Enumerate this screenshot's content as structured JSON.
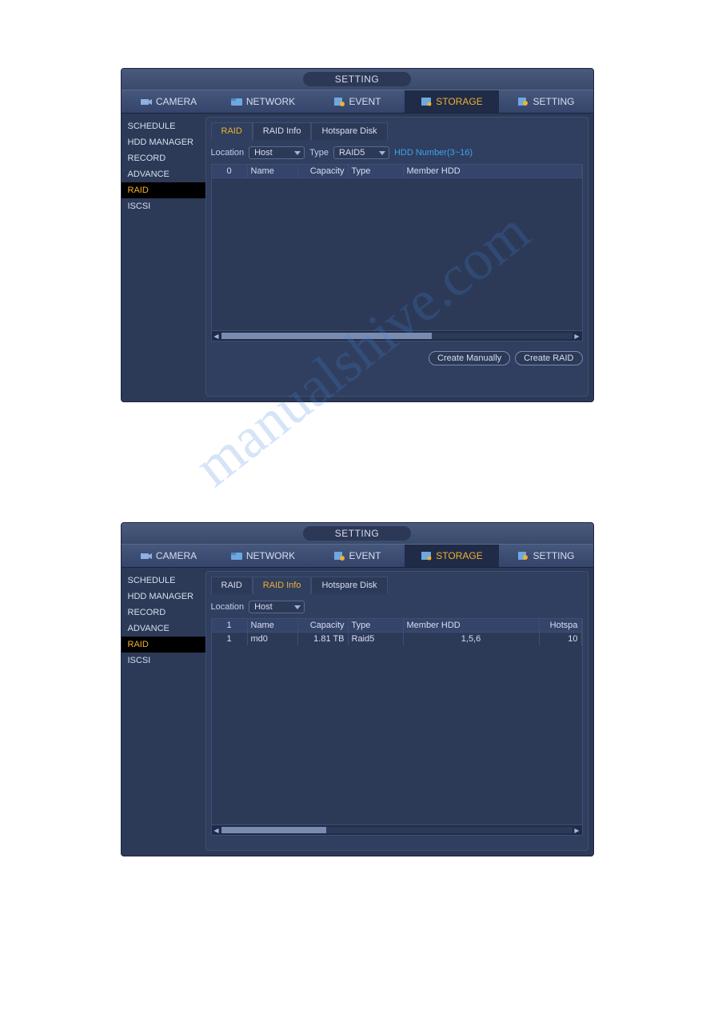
{
  "watermark_text": "manualshive.com",
  "window1": {
    "title": "SETTING",
    "tabs": [
      "CAMERA",
      "NETWORK",
      "EVENT",
      "STORAGE",
      "SETTING"
    ],
    "active_tab": "STORAGE",
    "sidebar": [
      "SCHEDULE",
      "HDD MANAGER",
      "RECORD",
      "ADVANCE",
      "RAID",
      "ISCSI"
    ],
    "sidebar_selected": "RAID",
    "subtabs": [
      "RAID",
      "RAID Info",
      "Hotspare Disk"
    ],
    "subtab_active": "RAID",
    "location_label": "Location",
    "location_value": "Host",
    "type_label": "Type",
    "type_value": "RAID5",
    "hdd_label": "HDD Number(3~16)",
    "columns": {
      "n": "0",
      "name": "Name",
      "capacity": "Capacity",
      "type": "Type",
      "member": "Member HDD"
    },
    "rows": [],
    "buttons": {
      "manual": "Create Manually",
      "raid": "Create RAID"
    }
  },
  "window2": {
    "title": "SETTING",
    "tabs": [
      "CAMERA",
      "NETWORK",
      "EVENT",
      "STORAGE",
      "SETTING"
    ],
    "active_tab": "STORAGE",
    "sidebar": [
      "SCHEDULE",
      "HDD MANAGER",
      "RECORD",
      "ADVANCE",
      "RAID",
      "ISCSI"
    ],
    "sidebar_selected": "RAID",
    "subtabs": [
      "RAID",
      "RAID Info",
      "Hotspare Disk"
    ],
    "subtab_active": "RAID Info",
    "location_label": "Location",
    "location_value": "Host",
    "columns": {
      "n": "1",
      "name": "Name",
      "capacity": "Capacity",
      "type": "Type",
      "member": "Member HDD",
      "hotspare": "Hotspa"
    },
    "rows": [
      {
        "n": "1",
        "name": "md0",
        "capacity": "1.81 TB",
        "type": "Raid5",
        "member": "1,5,6",
        "hotspare": "10"
      }
    ]
  }
}
